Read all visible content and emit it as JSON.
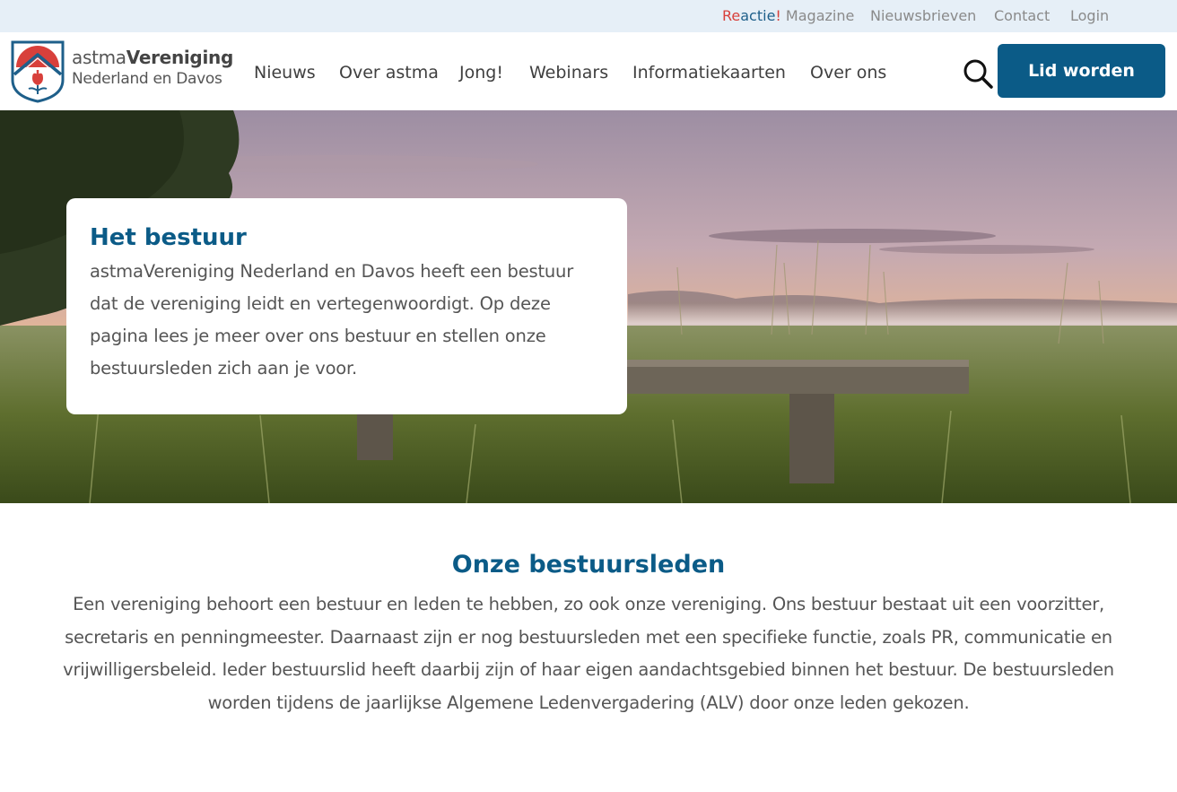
{
  "topbar": {
    "magazine_re": "Re",
    "magazine_actie": "actie",
    "magazine_bang": "!",
    "magazine_suffix": " Magazine",
    "newsletters": "Nieuwsbrieven",
    "contact": "Contact",
    "login": "Login"
  },
  "logo": {
    "line1_light": "astma",
    "line1_bold": "Vereniging",
    "line2": "Nederland en Davos"
  },
  "nav": {
    "items": [
      "Nieuws",
      "Over astma",
      "Jong!",
      "Webinars",
      "Informatiekaarten",
      "Over ons"
    ]
  },
  "header": {
    "search_icon": "search-icon",
    "cta_label": "Lid worden"
  },
  "hero": {
    "title": "Het bestuur",
    "text": "astmaVereniging Nederland en Davos heeft een bestuur dat de vereniging leidt en vertegenwoordigt. Op deze pagina lees je meer over ons bestuur en stellen onze bestuursleden zich aan je voor."
  },
  "section": {
    "title": "Onze bestuursleden",
    "text": "Een vereniging behoort een bestuur en leden te hebben, zo ook onze vereniging. Ons bestuur bestaat uit een voorzitter, secretaris en penningmeester. Daarnaast zijn er nog bestuursleden met een specifieke functie, zoals PR, communicatie en vrijwilligersbeleid. Ieder bestuurslid heeft daarbij zijn of haar eigen aandachtsgebied binnen het bestuur. De bestuursleden worden tijdens de jaarlijkse Algemene Ledenvergadering (ALV) door onze leden gekozen."
  },
  "colors": {
    "brand_blue": "#0b5b87",
    "accent_red": "#d8403b",
    "topbar_bg": "#e6eff7"
  }
}
